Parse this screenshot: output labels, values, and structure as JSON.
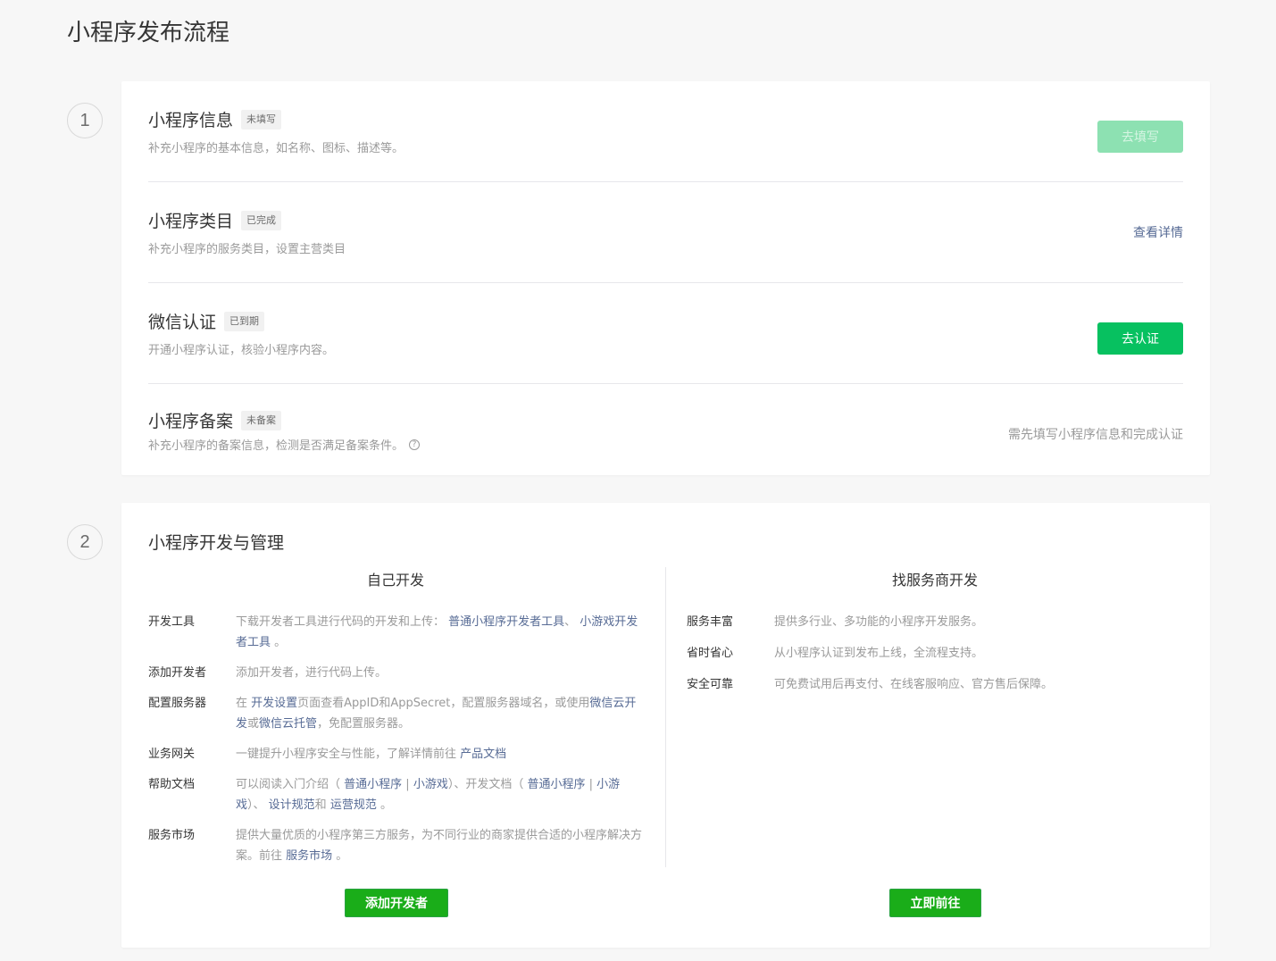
{
  "page": {
    "title": "小程序发布流程"
  },
  "steps": [
    {
      "number": "1"
    },
    {
      "number": "2"
    }
  ],
  "colors": {
    "primary": "#07c160",
    "primary_disabled": "#8de1b2",
    "link": "#576b95",
    "button_green": "#1aad19"
  },
  "step1": {
    "rows": [
      {
        "title": "小程序信息",
        "badge": "未填写",
        "desc": "补充小程序的基本信息，如名称、图标、描述等。",
        "action": "去填写",
        "action_state": "disabled"
      },
      {
        "title": "小程序类目",
        "badge": "已完成",
        "desc": "补充小程序的服务类目，设置主营类目",
        "action": "查看详情"
      },
      {
        "title": "微信认证",
        "badge": "已到期",
        "desc": "开通小程序认证，核验小程序内容。",
        "action": "去认证"
      },
      {
        "title": "小程序备案",
        "badge": "未备案",
        "desc": "补充小程序的备案信息，检测是否满足备案条件。",
        "help_icon": "question-circle-icon",
        "note": "需先填写小程序信息和完成认证"
      }
    ]
  },
  "step2": {
    "title": "小程序开发与管理",
    "left": {
      "heading": "自己开发",
      "items": [
        {
          "key": "开发工具",
          "t1": "下载开发者工具进行代码的开发和上传： ",
          "l1": "普通小程序开发者工具",
          "t2": "、 ",
          "l2": "小游戏开发者工具",
          "t3": " 。"
        },
        {
          "key": "添加开发者",
          "t1": "添加开发者，进行代码上传。"
        },
        {
          "key": "配置服务器",
          "t1": "在 ",
          "l1": "开发设置",
          "t2": "页面查看AppID和AppSecret，配置服务器域名，或使用",
          "l2": "微信云开发",
          "t3": "或",
          "l3": "微信云托管",
          "t4": "，免配置服务器。"
        },
        {
          "key": "业务网关",
          "t1": "一键提升小程序安全与性能，了解详情前往 ",
          "l1": "产品文档"
        },
        {
          "key": "帮助文档",
          "t1": "可以阅读入门介绍（ ",
          "l1": "普通小程序",
          "t2": " | ",
          "l2": "小游戏",
          "t3": "）、开发文档（ ",
          "l3": "普通小程序",
          "t4": " | ",
          "l4": "小游戏",
          "t5": "）、 ",
          "l5": "设计规范",
          "t6": "和 ",
          "l6": "运营规范",
          "t7": " 。"
        },
        {
          "key": "服务市场",
          "t1": "提供大量优质的小程序第三方服务，为不同行业的商家提供合适的小程序解决方案。前往 ",
          "l1": "服务市场",
          "t2": " 。"
        }
      ],
      "button": "添加开发者"
    },
    "right": {
      "heading": "找服务商开发",
      "items": [
        {
          "key": "服务丰富",
          "val": "提供多行业、多功能的小程序开发服务。"
        },
        {
          "key": "省时省心",
          "val": "从小程序认证到发布上线，全流程支持。"
        },
        {
          "key": "安全可靠",
          "val": "可免费试用后再支付、在线客服响应、官方售后保障。"
        }
      ],
      "button": "立即前往"
    }
  }
}
